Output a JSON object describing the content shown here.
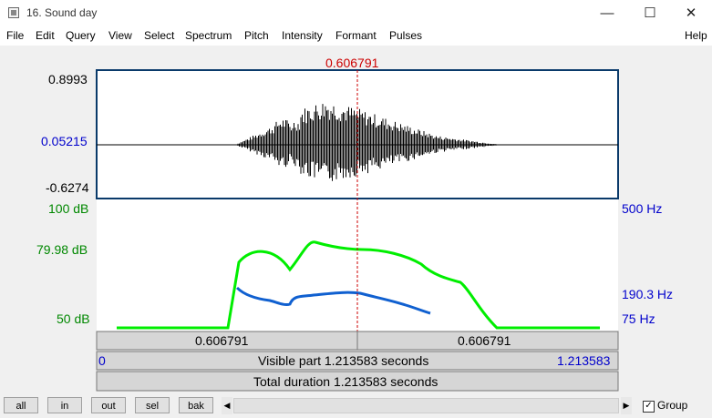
{
  "window": {
    "title": "16. Sound day",
    "minimize": "—",
    "maximize": "☐",
    "close": "✕"
  },
  "menu": [
    "File",
    "Edit",
    "Query",
    "View",
    "Select",
    "Spectrum",
    "Pitch",
    "Intensity",
    "Formant",
    "Pulses"
  ],
  "help": "Help",
  "cursor": {
    "time_label": "0.606791",
    "position_fraction": 0.5
  },
  "waveform": {
    "max_label": "0.8993",
    "zero_label": "0.05215",
    "min_label": "-0.6274"
  },
  "intensity": {
    "top_label": "100 dB",
    "mid_label": "79.98 dB",
    "bottom_label": "50 dB"
  },
  "pitch": {
    "top_label": "500 Hz",
    "mid_label": "190.3 Hz",
    "bottom_label": "75 Hz"
  },
  "segments": {
    "left": "0.606791",
    "right": "0.606791"
  },
  "visible": {
    "start": "0",
    "label": "Visible part 1.213583 seconds",
    "end": "1.213583"
  },
  "total": {
    "label": "Total duration 1.213583 seconds"
  },
  "buttons": {
    "all": "all",
    "in": "in",
    "out": "out",
    "sel": "sel",
    "bak": "bak"
  },
  "scroll": {
    "left_arrow": "◀",
    "right_arrow": "▶"
  },
  "group": {
    "label": "Group",
    "checked": "✓"
  },
  "colors": {
    "cursor": "#cc0000",
    "intensity": "#00ee00",
    "pitch": "#1060d0",
    "blue_label": "#0000cc",
    "green_label": "#008800"
  }
}
